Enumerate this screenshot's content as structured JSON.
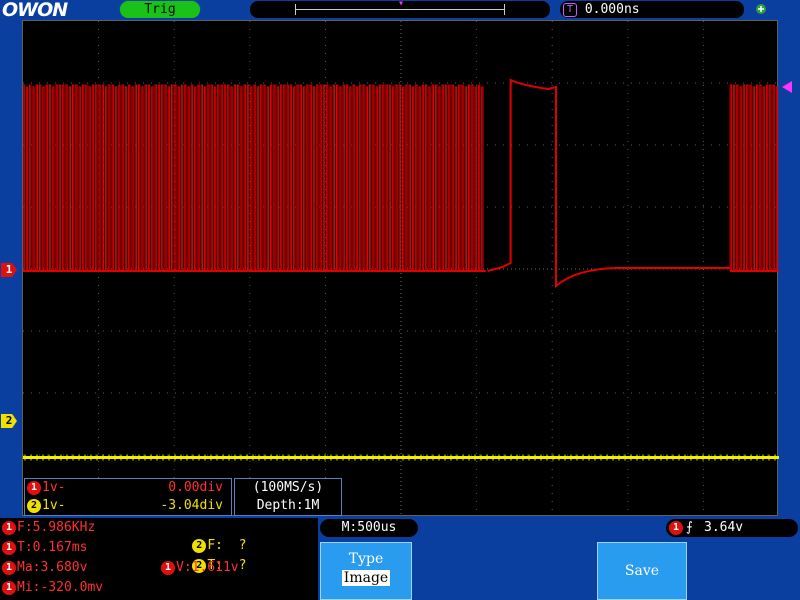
{
  "header": {
    "logo": "OWON",
    "trigger_status": "Trig",
    "horizontal_position": "0.000ns",
    "trigger_pos_symbol": "T"
  },
  "channels": {
    "ch1": {
      "number": "1",
      "color": "#e01010",
      "waveform_color": "#e00000"
    },
    "ch2": {
      "number": "2",
      "color": "#f0e000",
      "waveform_color": "#f0f000"
    }
  },
  "cursor_panel": {
    "rows": [
      {
        "channel": "1",
        "label": "1v-",
        "value": "0.00div"
      },
      {
        "channel": "2",
        "label": "1v-",
        "value": "-3.04div"
      }
    ],
    "sample_rate": "(100MS/s)",
    "depth": "Depth:1M"
  },
  "measurements": [
    {
      "channel": "1",
      "text": "F:5.986KHz"
    },
    {
      "channel": "1",
      "text": "T:0.167ms"
    },
    {
      "channel": "1",
      "text": "Ma:3.680v"
    },
    {
      "channel": "1",
      "text": "Mi:-320.0mv"
    },
    {
      "channel": "2",
      "text": "F:  ?"
    },
    {
      "channel": "2",
      "text": "T:  ?"
    },
    {
      "channel": "1",
      "text": "V:1.611v"
    }
  ],
  "timebase": "M:500us",
  "trigger": {
    "channel": "1",
    "edge_symbol": "⨍",
    "level": "3.64v"
  },
  "softkeys": {
    "type_title": "Type",
    "type_value": "Image",
    "save": "Save"
  },
  "waveform": {
    "ch1_high_div": 3.0,
    "ch1_low_div": 0.0,
    "ch2_level_div": -3.04,
    "gap_start_div": 6.2,
    "gap_end_div": 9.3,
    "pulse_start_div": 6.45,
    "pulse_end_div": 7.05
  }
}
